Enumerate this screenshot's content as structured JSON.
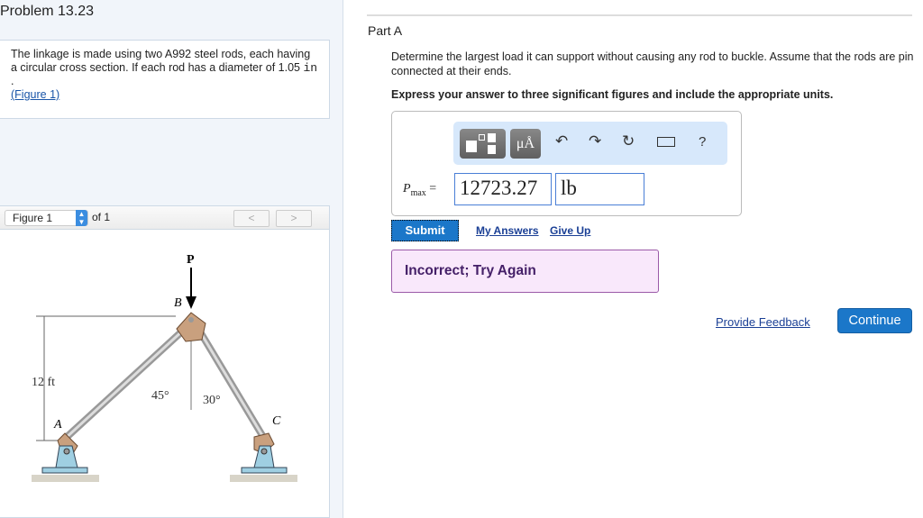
{
  "problem": {
    "title": "Problem 13.23",
    "text": "The linkage is made using two A992 steel rods, each having a circular cross section. If each rod has a diameter of 1.05 ",
    "unit": "in",
    "after": " .",
    "figure_link": "(Figure 1)"
  },
  "figure": {
    "select": "Figure 1",
    "of": "of 1",
    "prev": "<",
    "next": ">",
    "labels": {
      "P": "P",
      "B": "B",
      "A": "A",
      "C": "C",
      "height": "12 ft",
      "angle1": "45°",
      "angle2": "30°"
    }
  },
  "part": {
    "title": "Part A",
    "question": "Determine the largest load it can support without causing any rod to buckle. Assume that the rods are pin connected at their ends.",
    "instruction": "Express your answer to three significant figures and include the appropriate units.",
    "toolbar": {
      "units": "μÅ",
      "help": "?"
    },
    "var": "P",
    "var_sub": "max",
    "eq": " =",
    "value": "12723.27",
    "unit": "lb",
    "submit": "Submit",
    "my_answers": "My Answers",
    "give_up": "Give Up",
    "feedback": "Incorrect; Try Again"
  },
  "footer": {
    "provide_feedback": "Provide Feedback",
    "continue": "Continue"
  }
}
